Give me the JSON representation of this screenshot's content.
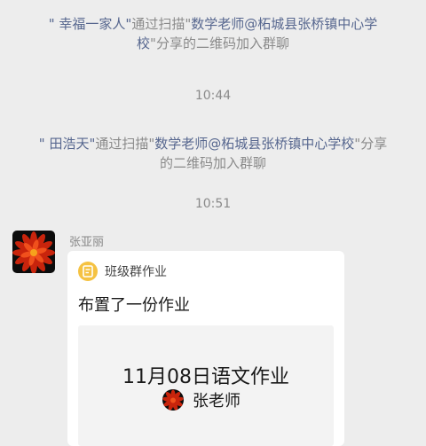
{
  "messages": {
    "join1": {
      "q_open": "\"",
      "user": " 幸福一家人",
      "q_mid1": "\"",
      "via": "通过扫描",
      "q_mid2": "\"",
      "inviter": "数学老师@柘城县张桥镇中心学校",
      "q_close": "\"",
      "action": "分享的二维码加入群聊"
    },
    "time1": "10:44",
    "join2": {
      "q_open": "\"",
      "user": " 田浩天",
      "q_mid1": "\"",
      "via": "通过扫描",
      "q_mid2": "\"",
      "inviter": "数学老师@柘城县张桥镇中心学校",
      "q_close": "\"",
      "action": "分享的二维码加入群聊"
    },
    "time2": "10:51"
  },
  "chat": {
    "sender_name": "张亚丽",
    "avatar_icon": "red-flower-avatar",
    "card": {
      "app_name": "班级群作业",
      "app_icon": "homework-app-icon",
      "app_icon_color": "#f5c242",
      "description": "布置了一份作业",
      "homework_title": "11月08日语文作业",
      "teacher_name": "张老师"
    }
  },
  "colors": {
    "background": "#ededed",
    "system_text": "#8a8a8a",
    "link_text": "#57678f",
    "card_bg": "#ffffff",
    "inner_bg": "#f3f3f3"
  }
}
